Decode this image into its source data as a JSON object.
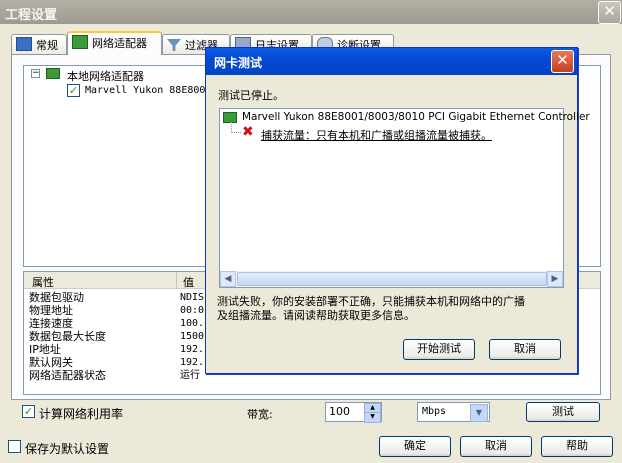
{
  "window": {
    "title": "工程设置",
    "close": "✕"
  },
  "tabs": [
    {
      "label": "常规"
    },
    {
      "label": "网络适配器"
    },
    {
      "label": "过滤器"
    },
    {
      "label": "日志设置"
    },
    {
      "label": "诊断设置"
    }
  ],
  "tree": {
    "root": "本地网络适配器",
    "child": "Marvell Yukon 88E800"
  },
  "properties": {
    "col_name": "属性",
    "col_value": "值",
    "rows": [
      {
        "name": "数据包驱动",
        "value": "NDIS"
      },
      {
        "name": "物理地址",
        "value": "00:0"
      },
      {
        "name": "连接速度",
        "value": "100."
      },
      {
        "name": "数据包最大长度",
        "value": "1500"
      },
      {
        "name": "IP地址",
        "value": "192."
      },
      {
        "name": "默认网关",
        "value": "192."
      },
      {
        "name": "网络适配器状态",
        "value": "运行"
      }
    ]
  },
  "bottom": {
    "calc_util_label": "计算网络利用率",
    "bandwidth_label": "带宽:",
    "bandwidth_value": "100",
    "unit_value": "Mbps",
    "test_button": "测试",
    "save_default_label": "保存为默认设置",
    "ok": "确定",
    "cancel": "取消",
    "help": "帮助"
  },
  "dialog": {
    "title": "网卡测试",
    "close": "✕",
    "status": "测试已停止。",
    "adapter": "Marvell Yukon 88E8001/8003/8010 PCI Gigabit Ethernet Controller",
    "error": "捕获流量：只有本机和广播或组播流量被捕获。",
    "message_line1": "测试失败，你的安装部署不正确，只能捕获本机和网络中的广播",
    "message_line2": "及组播流量。请阅读帮助获取更多信息。",
    "start_button": "开始测试",
    "cancel_button": "取消"
  }
}
